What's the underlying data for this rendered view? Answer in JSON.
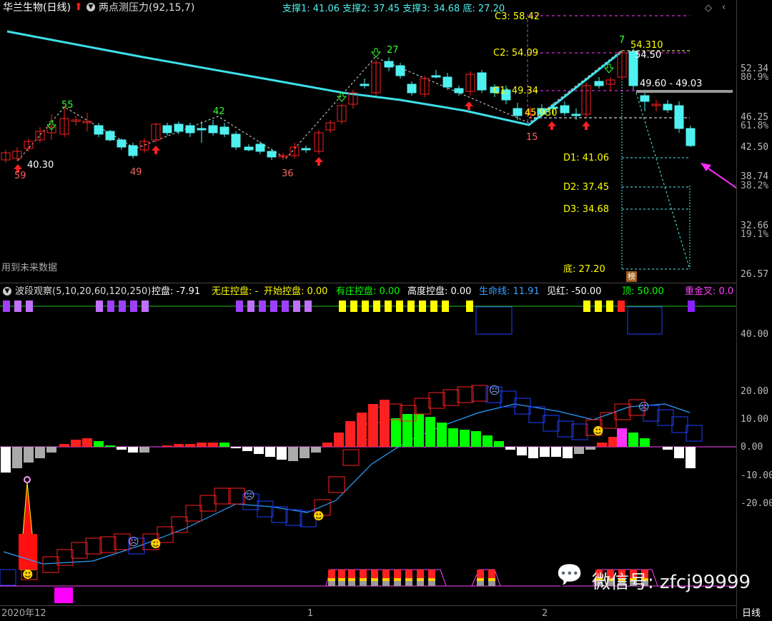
{
  "header": {
    "stock_name": "华兰生物(日线)",
    "indicator_name": "两点测压力(92,15,7)",
    "support_summary": "支撑1: 41.06  支撑2: 37.45  支撑3: 34.68  底: 27.20"
  },
  "main_chart": {
    "watermark": "用到未来数据",
    "c_labels": [
      "C3: 58.42",
      "C2: 54.09",
      "C1: 49.34"
    ],
    "d_labels": [
      "D1: 41.06",
      "D2: 37.45",
      "D3: 34.68",
      "底: 27.20"
    ],
    "price_notes": [
      "40.30",
      "54.310",
      "54.50",
      "49.60 - 49.03",
      "45.930"
    ],
    "pivot_numbers": [
      "59",
      "55",
      "49",
      "42",
      "36",
      "27",
      "15",
      "7"
    ],
    "rank_badge": "榜",
    "right_axis": [
      "52.34",
      "80.9%",
      "46.25",
      "61.8%",
      "42.50",
      "38.74",
      "38.2%",
      "32.66",
      "19.1%",
      "26.57"
    ]
  },
  "indicator_panel": {
    "title": "波段观察(5,10,20,60,120,250)",
    "items": [
      {
        "label": "控盘: -7.91",
        "color": "#ffffff"
      },
      {
        "label": "无庄控盘: -",
        "color": "#ffff00"
      },
      {
        "label": "开始控盘: 0.00",
        "color": "#ffff00"
      },
      {
        "label": "有庄控盘: 0.00",
        "color": "#00ff00"
      },
      {
        "label": "高度控盘: 0.00",
        "color": "#ffffff"
      },
      {
        "label": "生命线: 11.91",
        "color": "#3aa0ff"
      },
      {
        "label": "见红: -50.00",
        "color": "#ffffff"
      },
      {
        "label": "顶: 50.00",
        "color": "#00ff00"
      },
      {
        "label": "重金叉: 0.0",
        "color": "#ff44ff"
      }
    ],
    "right_axis": [
      "40.00",
      "20.00",
      "10.00",
      "0.00",
      "-10.00",
      "-20.00"
    ]
  },
  "footer": {
    "date_start": "2020年12",
    "tick_1": "1",
    "tick_2": "2",
    "period": "日线",
    "wechat_watermark": "微信号: zfcj99999"
  },
  "colors": {
    "up": "#ff2020",
    "down": "#4ff0f0",
    "yellow": "#ffff00",
    "magenta": "#ff00ff",
    "green": "#00ff00"
  }
}
